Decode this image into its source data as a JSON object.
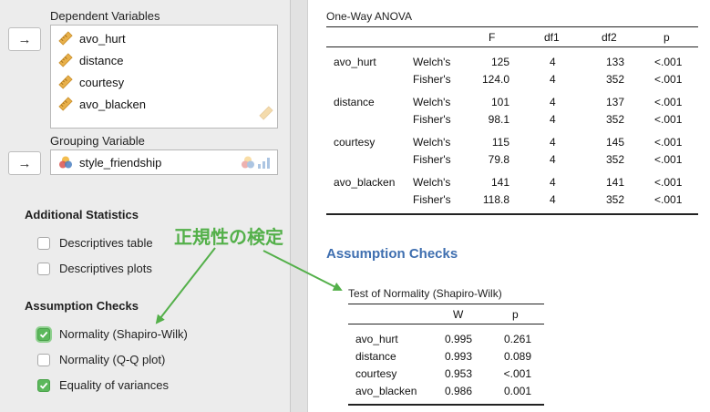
{
  "left_panel": {
    "dependent_label": "Dependent Variables",
    "dependent_vars": [
      "avo_hurt",
      "distance",
      "courtesy",
      "avo_blacken"
    ],
    "grouping_label": "Grouping Variable",
    "grouping_var": "style_friendship",
    "move_arrow": "→",
    "additional_head": "Additional Statistics",
    "additional_options": [
      {
        "label": "Descriptives table",
        "checked": false
      },
      {
        "label": "Descriptives plots",
        "checked": false
      }
    ],
    "assumption_head": "Assumption Checks",
    "assumption_options": [
      {
        "label": "Normality (Shapiro-Wilk)",
        "checked": true
      },
      {
        "label": "Normality (Q-Q plot)",
        "checked": false
      },
      {
        "label": "Equality of variances",
        "checked": true
      }
    ]
  },
  "annotation": {
    "text": "正規性の検定",
    "color": "#54b04a"
  },
  "anova": {
    "title": "One-Way ANOVA",
    "columns": [
      "F",
      "df1",
      "df2",
      "p"
    ],
    "rows": [
      {
        "var": "avo_hurt",
        "test": "Welch's",
        "F": "125",
        "df1": "4",
        "df2": "133",
        "p": "<.001"
      },
      {
        "var": "",
        "test": "Fisher's",
        "F": "124.0",
        "df1": "4",
        "df2": "352",
        "p": "<.001"
      },
      {
        "var": "distance",
        "test": "Welch's",
        "F": "101",
        "df1": "4",
        "df2": "137",
        "p": "<.001"
      },
      {
        "var": "",
        "test": "Fisher's",
        "F": "98.1",
        "df1": "4",
        "df2": "352",
        "p": "<.001"
      },
      {
        "var": "courtesy",
        "test": "Welch's",
        "F": "115",
        "df1": "4",
        "df2": "145",
        "p": "<.001"
      },
      {
        "var": "",
        "test": "Fisher's",
        "F": "79.8",
        "df1": "4",
        "df2": "352",
        "p": "<.001"
      },
      {
        "var": "avo_blacken",
        "test": "Welch's",
        "F": "141",
        "df1": "4",
        "df2": "141",
        "p": "<.001"
      },
      {
        "var": "",
        "test": "Fisher's",
        "F": "118.8",
        "df1": "4",
        "df2": "352",
        "p": "<.001"
      }
    ]
  },
  "assumption_checks": {
    "heading": "Assumption Checks",
    "normality_title": "Test of Normality (Shapiro-Wilk)",
    "columns": [
      "W",
      "p"
    ],
    "rows": [
      {
        "var": "avo_hurt",
        "W": "0.995",
        "p": "0.261"
      },
      {
        "var": "distance",
        "W": "0.993",
        "p": "0.089"
      },
      {
        "var": "courtesy",
        "W": "0.953",
        "p": "<.001"
      },
      {
        "var": "avo_blacken",
        "W": "0.986",
        "p": "0.001"
      }
    ]
  },
  "colors": {
    "accent_heading": "#3f6fb0",
    "checkbox_green": "#5cb85c",
    "annotation_green": "#54b04a",
    "ruler_icon": "#e8b04a"
  }
}
